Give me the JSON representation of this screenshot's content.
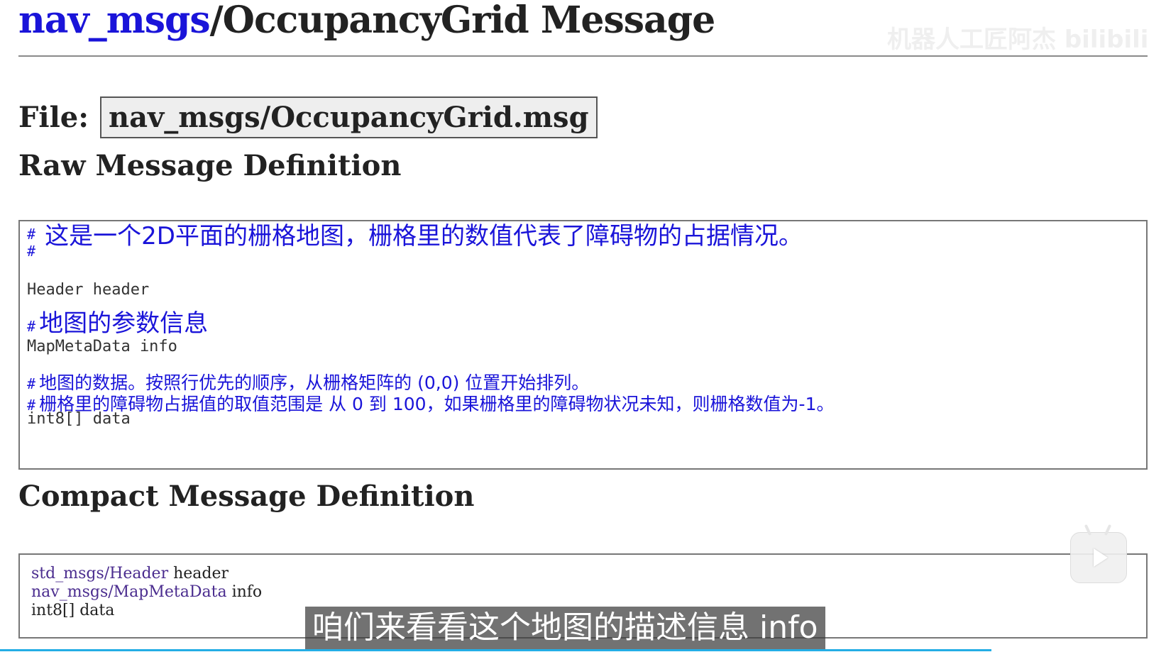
{
  "page": {
    "title_pkg": "nav_msgs",
    "title_rest": "/OccupancyGrid Message",
    "watermark": "机器人工匠阿杰 bilibili"
  },
  "file": {
    "label": "File:",
    "path": "nav_msgs/OccupancyGrid.msg"
  },
  "raw": {
    "heading": "Raw Message Definition",
    "hash": "#",
    "comment_1": "这是一个2D平面的栅格地图，栅格里的数值代表了障碍物的占据情况。",
    "field_header": "Header header",
    "comment_2": "地图的参数信息",
    "field_info": "MapMetaData info",
    "comment_3": "地图的数据。按照行优先的顺序，从栅格矩阵的 (0,0) 位置开始排列。",
    "comment_4": "栅格里的障碍物占据值的取值范围是 从 0 到 100，如果栅格里的障碍物状况未知，则栅格数值为-1。",
    "field_data": "int8[] data"
  },
  "compact": {
    "heading": "Compact Message Definition",
    "line1_type": "std_msgs/Header",
    "line1_name": " header",
    "line2_type": "nav_msgs/MapMetaData",
    "line2_name": " info",
    "line3": "int8[] data"
  },
  "player": {
    "subtitle": "咱们来看看这个地图的描述信息 info",
    "progress_fraction": 0.85,
    "play_icon": "play-icon"
  },
  "colors": {
    "link": "#1a14d9",
    "comment": "#1a14d9",
    "compact_type": "#4b2d8f",
    "progress": "#23ade5"
  }
}
